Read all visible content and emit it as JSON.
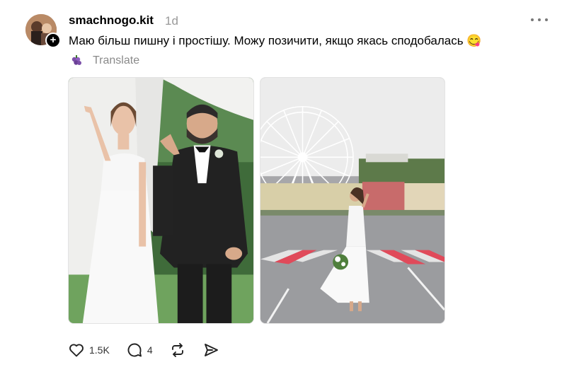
{
  "post": {
    "username": "smachnogo.kit",
    "timestamp": "1d",
    "caption": "Маю більш пишну і простішу. Можу позичити, якщо якась сподобалась 😋",
    "translate_label": "Translate",
    "images": [
      "wedding-couple-photo",
      "bride-ferris-wheel-photo"
    ]
  },
  "actions": {
    "likes": "1.5K",
    "replies": "4"
  },
  "icons": {
    "avatar": "avatar",
    "follow": "plus-icon",
    "more": "more-icon",
    "translate": "grapes-icon",
    "like": "heart-icon",
    "reply": "comment-icon",
    "repost": "repost-icon",
    "share": "share-icon"
  },
  "colors": {
    "text": "#000000",
    "muted": "#999999",
    "bride_dress": "#f4f4f4",
    "suit": "#222222",
    "crosswalk": "#e04a5a"
  }
}
